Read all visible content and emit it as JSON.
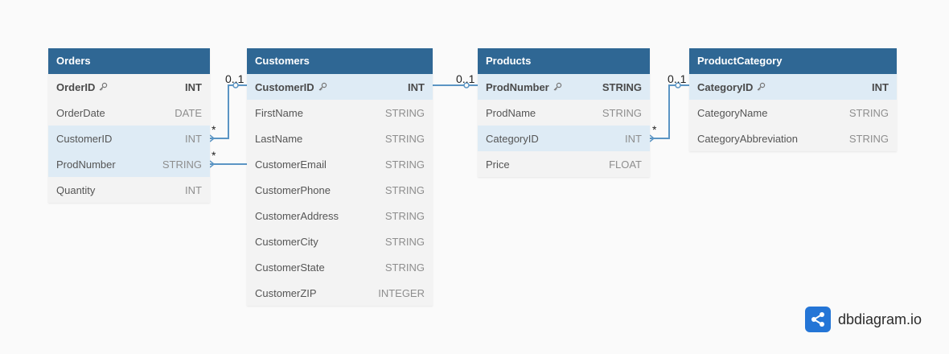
{
  "tables": [
    {
      "name": "Orders",
      "fields": [
        {
          "name": "OrderID",
          "type": "INT",
          "pk": true,
          "highlight": false
        },
        {
          "name": "OrderDate",
          "type": "DATE",
          "pk": false,
          "highlight": false
        },
        {
          "name": "CustomerID",
          "type": "INT",
          "pk": false,
          "highlight": true
        },
        {
          "name": "ProdNumber",
          "type": "STRING",
          "pk": false,
          "highlight": true
        },
        {
          "name": "Quantity",
          "type": "INT",
          "pk": false,
          "highlight": false
        }
      ]
    },
    {
      "name": "Customers",
      "fields": [
        {
          "name": "CustomerID",
          "type": "INT",
          "pk": true,
          "highlight": true
        },
        {
          "name": "FirstName",
          "type": "STRING",
          "pk": false,
          "highlight": false
        },
        {
          "name": "LastName",
          "type": "STRING",
          "pk": false,
          "highlight": false
        },
        {
          "name": "CustomerEmail",
          "type": "STRING",
          "pk": false,
          "highlight": false
        },
        {
          "name": "CustomerPhone",
          "type": "STRING",
          "pk": false,
          "highlight": false
        },
        {
          "name": "CustomerAddress",
          "type": "STRING",
          "pk": false,
          "highlight": false
        },
        {
          "name": "CustomerCity",
          "type": "STRING",
          "pk": false,
          "highlight": false
        },
        {
          "name": "CustomerState",
          "type": "STRING",
          "pk": false,
          "highlight": false
        },
        {
          "name": "CustomerZIP",
          "type": "INTEGER",
          "pk": false,
          "highlight": false
        }
      ]
    },
    {
      "name": "Products",
      "fields": [
        {
          "name": "ProdNumber",
          "type": "STRING",
          "pk": true,
          "highlight": true
        },
        {
          "name": "ProdName",
          "type": "STRING",
          "pk": false,
          "highlight": false
        },
        {
          "name": "CategoryID",
          "type": "INT",
          "pk": false,
          "highlight": true
        },
        {
          "name": "Price",
          "type": "FLOAT",
          "pk": false,
          "highlight": false
        }
      ]
    },
    {
      "name": "ProductCategory",
      "fields": [
        {
          "name": "CategoryID",
          "type": "INT",
          "pk": true,
          "highlight": true
        },
        {
          "name": "CategoryName",
          "type": "STRING",
          "pk": false,
          "highlight": false
        },
        {
          "name": "CategoryAbbreviation",
          "type": "STRING",
          "pk": false,
          "highlight": false
        }
      ]
    }
  ],
  "relationships": [
    {
      "from_table": "Orders",
      "from_field": "CustomerID",
      "from_card": "*",
      "to_table": "Customers",
      "to_field": "CustomerID",
      "to_card": "0..1"
    },
    {
      "from_table": "Orders",
      "from_field": "ProdNumber",
      "from_card": "*",
      "to_table": "Products",
      "to_field": "ProdNumber",
      "to_card": "0..1"
    },
    {
      "from_table": "Products",
      "from_field": "CategoryID",
      "from_card": "*",
      "to_table": "ProductCategory",
      "to_field": "CategoryID",
      "to_card": "0..1"
    }
  ],
  "brand": {
    "text": "dbdiagram.io"
  },
  "colors": {
    "header": "#2f6794",
    "row": "#f3f3f3",
    "highlight_row": "#deebf5",
    "connector": "#5b95c4",
    "brand_logo": "#2475d6"
  }
}
